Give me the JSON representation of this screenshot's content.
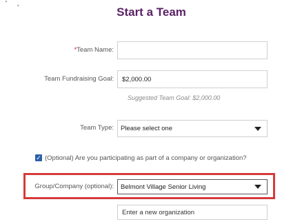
{
  "header": {
    "corner_mark": "' ,",
    "title": "Start a Team"
  },
  "form": {
    "team_name": {
      "required_marker": "*",
      "label": "Team Name:",
      "value": ""
    },
    "fundraising_goal": {
      "label": "Team Fundraising Goal:",
      "value": "$2,000.00",
      "hint": "Suggested Team Goal: $2,000.00"
    },
    "team_type": {
      "label": "Team Type:",
      "selected": "Please select one"
    },
    "company_checkbox": {
      "checked": true,
      "label": "(Optional) Are you participating as part of a company or organization?"
    },
    "group_company": {
      "label": "Group/Company (optional):",
      "selected": "Belmont Village Senior Living"
    },
    "new_organization": {
      "placeholder": "Enter a new organization"
    }
  },
  "colors": {
    "title": "#5b2166",
    "required": "#d21f2a",
    "checkbox": "#2d5fa8",
    "highlight": "#d63a3a"
  },
  "icons": {
    "dropdown": "chevron-down-icon",
    "check": "check-icon"
  }
}
